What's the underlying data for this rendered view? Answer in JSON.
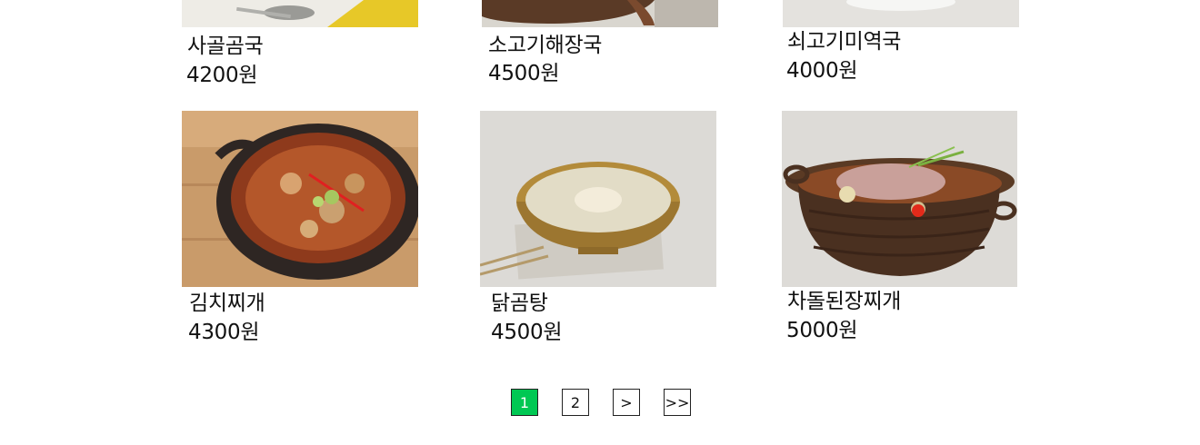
{
  "colors": {
    "accent": "#00c853",
    "border": "#222222"
  },
  "top_row": [
    {
      "name": "사골곰국",
      "price": "4200원",
      "image": "beef-bone-soup-photo"
    },
    {
      "name": "소고기해장국",
      "price": "4500원",
      "image": "beef-hangover-soup-photo"
    },
    {
      "name": "쇠고기미역국",
      "price": "4000원",
      "image": "beef-seaweed-soup-photo"
    }
  ],
  "bottom_row": [
    {
      "name": "김치찌개",
      "price": "4300원",
      "image": "kimchi-stew-photo"
    },
    {
      "name": "닭곰탕",
      "price": "4500원",
      "image": "chicken-soup-photo"
    },
    {
      "name": "차돌된장찌개",
      "price": "5000원",
      "image": "brisket-soybean-stew-photo"
    }
  ],
  "pagination": {
    "pages": [
      "1",
      "2"
    ],
    "current": "1",
    "next": ">",
    "last": ">>"
  }
}
